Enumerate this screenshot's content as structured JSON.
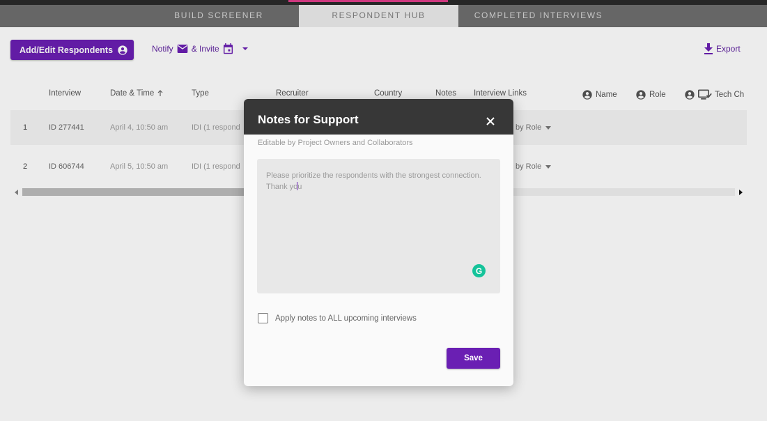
{
  "tabs": [
    {
      "label": "BUILD SCREENER"
    },
    {
      "label": "RESPONDENT HUB"
    },
    {
      "label": "COMPLETED INTERVIEWS"
    }
  ],
  "toolbar": {
    "add_edit_label": "Add/Edit Respondents",
    "notify_label": "Notify",
    "invite_label": "& Invite",
    "export_label": "Export"
  },
  "table": {
    "columns": [
      "Interview",
      "Date & Time",
      "Type",
      "Recruiter",
      "Country",
      "Notes",
      "Interview Links",
      "Name",
      "Role",
      "Tech Ch"
    ],
    "rows": [
      {
        "num": "1",
        "interview": "ID 277441",
        "datetime": "April 4, 10:50 am",
        "type": "IDI (1 respond",
        "links": "by Role"
      },
      {
        "num": "2",
        "interview": "ID 606744",
        "datetime": "April 5, 10:50 am",
        "type": "IDI (1 respond",
        "links": "by Role"
      }
    ]
  },
  "modal": {
    "title": "Notes for Support",
    "subtitle": "Editable by Project Owners and Collaborators",
    "notes_text_before_caret": "Please prioritize the respondents with the strongest connection. Thank yo",
    "notes_text_after_caret": "u",
    "grammarly_letter": "G",
    "apply_all_label": "Apply notes to ALL upcoming interviews",
    "apply_all_checked": false,
    "save_label": "Save"
  },
  "colors": {
    "primary": "#6a1fb3",
    "tab_active_indicator": "#e03d8a",
    "modal_header": "#373737",
    "grammarly": "#15c39a"
  }
}
